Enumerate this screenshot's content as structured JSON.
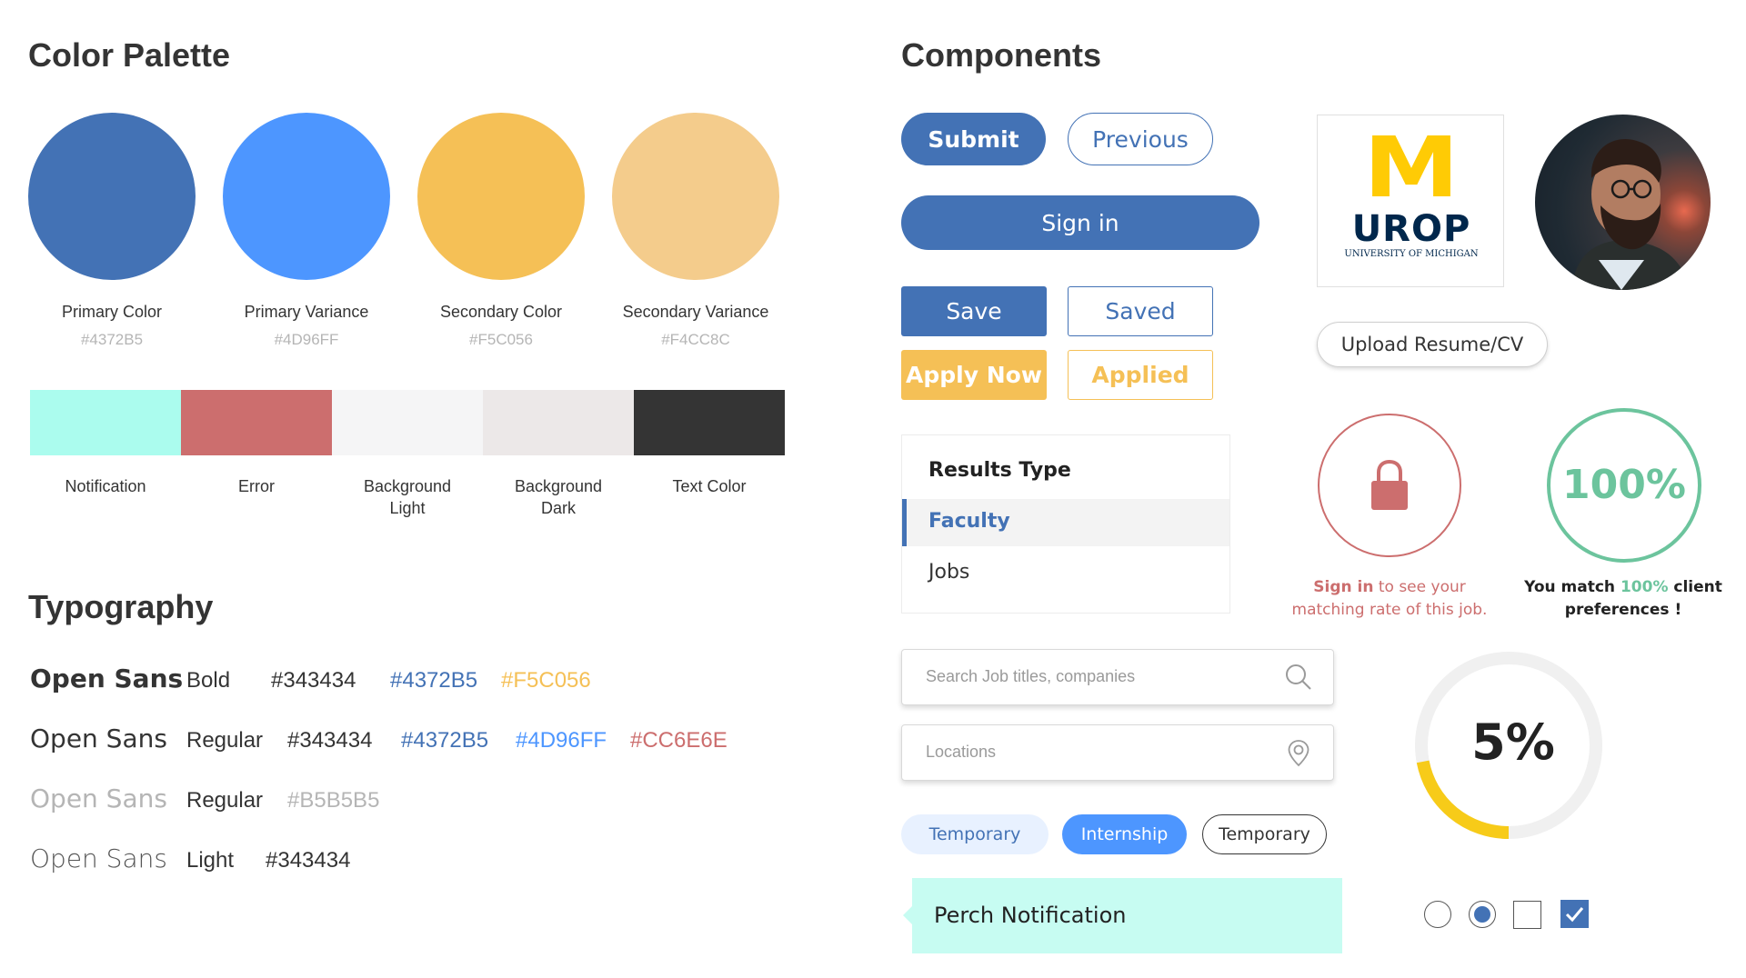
{
  "palette": {
    "title": "Color Palette",
    "circles": [
      {
        "name": "Primary Color",
        "hex": "#4372B5",
        "color": "#4372B5"
      },
      {
        "name": "Primary Variance",
        "hex": "#4D96FF",
        "color": "#4D96FF"
      },
      {
        "name": "Secondary Color",
        "hex": "#F5C056",
        "color": "#F5C056"
      },
      {
        "name": "Secondary Variance",
        "hex": "#F4CC8C",
        "color": "#F4CC8C"
      }
    ],
    "bars": [
      {
        "name": "Notification",
        "color": "#ABFCEE"
      },
      {
        "name": "Error",
        "color": "#CC6E6E"
      },
      {
        "name": "Background\nLight",
        "color": "#F5F5F6"
      },
      {
        "name": "Background\nDark",
        "color": "#ECE8E8"
      },
      {
        "name": "Text Color",
        "color": "#343434"
      }
    ]
  },
  "typography": {
    "title": "Typography",
    "rows": [
      {
        "font": "Open Sans",
        "weight": "Bold",
        "colors": [
          "#343434",
          "#4372B5",
          "#F5C056"
        ]
      },
      {
        "font": "Open Sans",
        "weight": "Regular",
        "colors": [
          "#343434",
          "#4372B5",
          "#4D96FF",
          "#CC6E6E"
        ]
      },
      {
        "font": "Open Sans",
        "weight": "Regular",
        "colors": [
          "#B5B5B5"
        ]
      },
      {
        "font": "Open Sans",
        "weight": "Light",
        "colors": [
          "#343434"
        ]
      }
    ]
  },
  "components": {
    "title": "Components",
    "submit": "Submit",
    "previous": "Previous",
    "sign_in": "Sign in",
    "save": "Save",
    "saved": "Saved",
    "apply_now": "Apply Now",
    "applied": "Applied",
    "results": {
      "title": "Results Type",
      "items": [
        "Faculty",
        "Jobs"
      ],
      "selected": "Faculty"
    },
    "search_placeholder": "Search Job titles, companies",
    "location_placeholder": "Locations",
    "tags": [
      "Temporary",
      "Internship",
      "Temporary"
    ],
    "notification": "Perch Notification",
    "logo": {
      "letter": "M",
      "name": "UROP",
      "sub": "UNIVERSITY OF MICHIGAN"
    },
    "upload": "Upload Resume/CV",
    "lock_note": {
      "strong": "Sign in",
      "rest1": " to see your",
      "rest2": "matching rate of this job."
    },
    "match": {
      "value": "100%",
      "pre": "You match ",
      "pct": "100%",
      "post": " client",
      "line2": "preferences !"
    },
    "progress": {
      "label": "5%",
      "value": 0.22
    },
    "colors": {
      "primary": "#4372B5",
      "yellow": "#F5C056",
      "green": "#6CC49D",
      "error": "#CC6E6E",
      "progress": "#F7CB19"
    }
  }
}
